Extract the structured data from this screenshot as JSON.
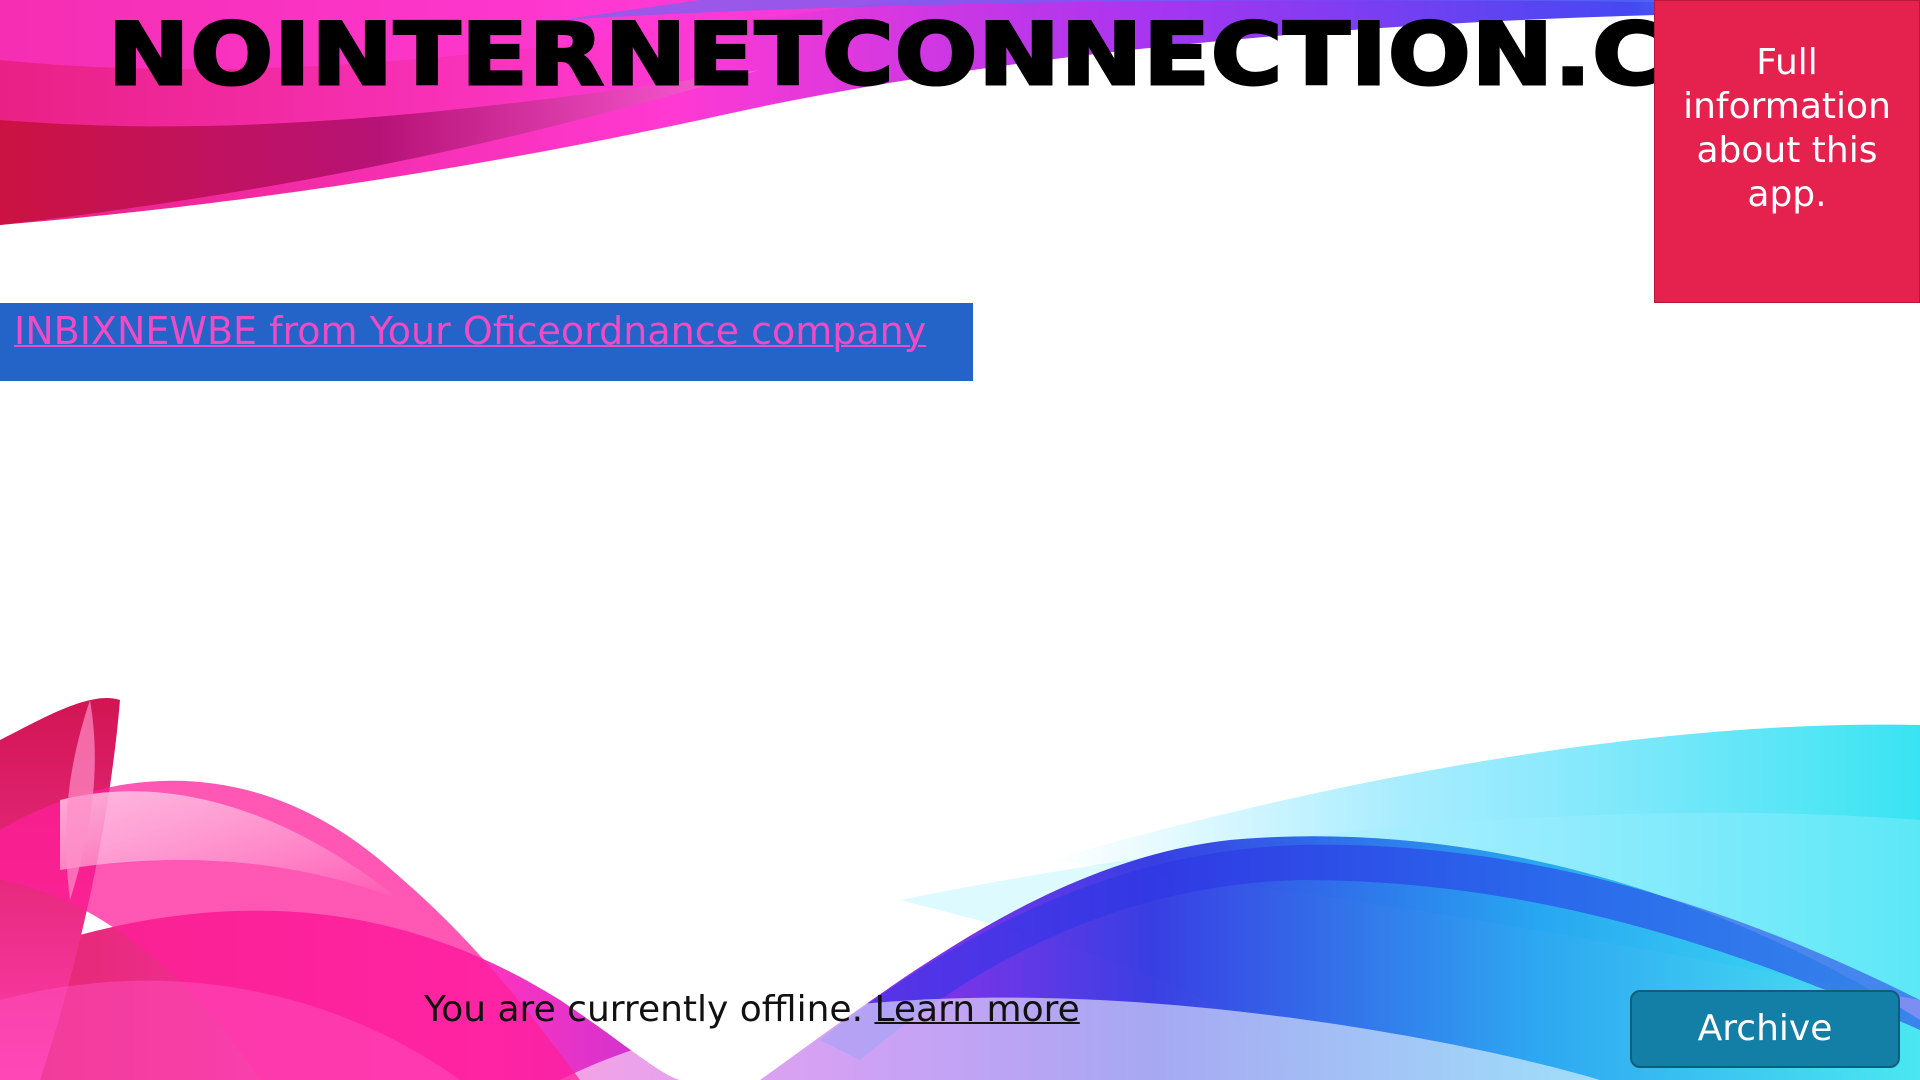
{
  "header": {
    "site_title": "nointernetconnection.com"
  },
  "info_panel": {
    "text": "Full information about this app."
  },
  "link_bar": {
    "link_text": "INBIXNEWBE from Your Oficeordnance company"
  },
  "footer": {
    "offline_text": "You are currently offline.",
    "learn_more": "Learn more",
    "archive_label": "Archive"
  },
  "colors": {
    "info_panel_bg": "#e5224e",
    "link_bar_bg": "#2463c7",
    "link_text": "#f04bc4",
    "archive_button_bg": "#147fa6",
    "wave_magenta": "#e8157e",
    "wave_purple": "#5a1ee0",
    "wave_cyan": "#3ee6f0"
  }
}
